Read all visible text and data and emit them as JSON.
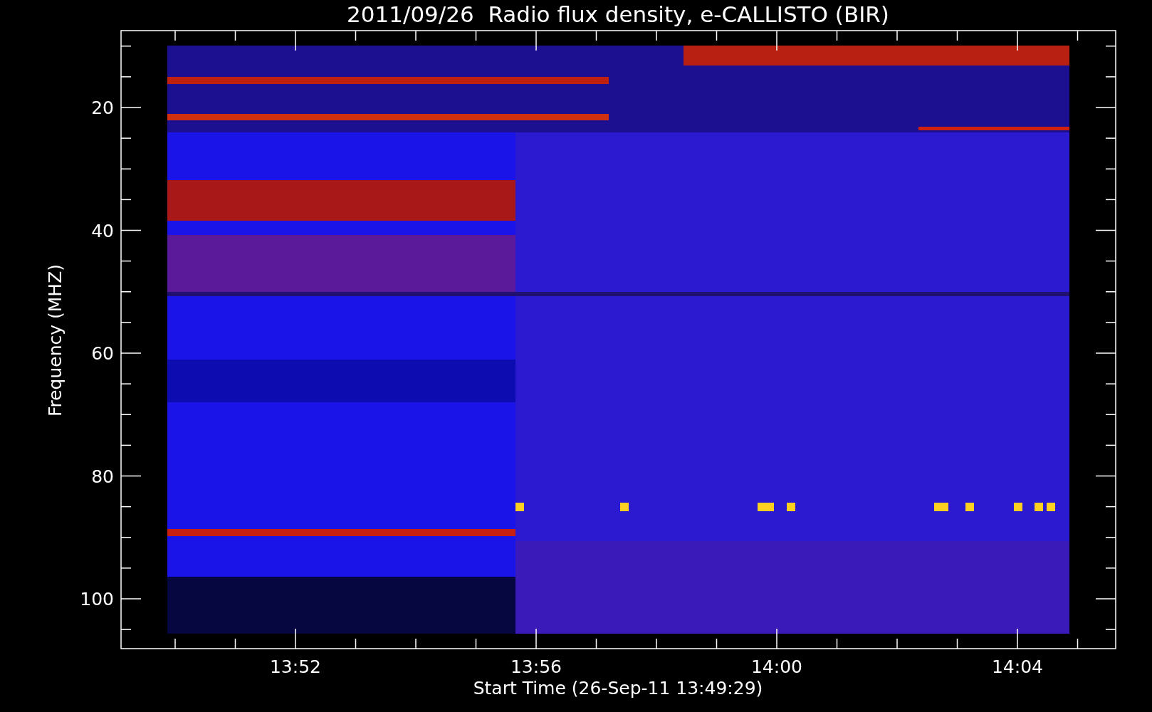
{
  "title": "2011/09/26  Radio flux density, e-CALLISTO (BIR)",
  "y_axis": {
    "label": "Frequency (MHZ)",
    "ticks": [
      "20",
      "40",
      "60",
      "80",
      "100"
    ]
  },
  "x_axis": {
    "label": "Start Time (26-Sep-11 13:49:29)",
    "ticks": [
      "13:52",
      "13:56",
      "14:00",
      "14:04"
    ]
  }
}
